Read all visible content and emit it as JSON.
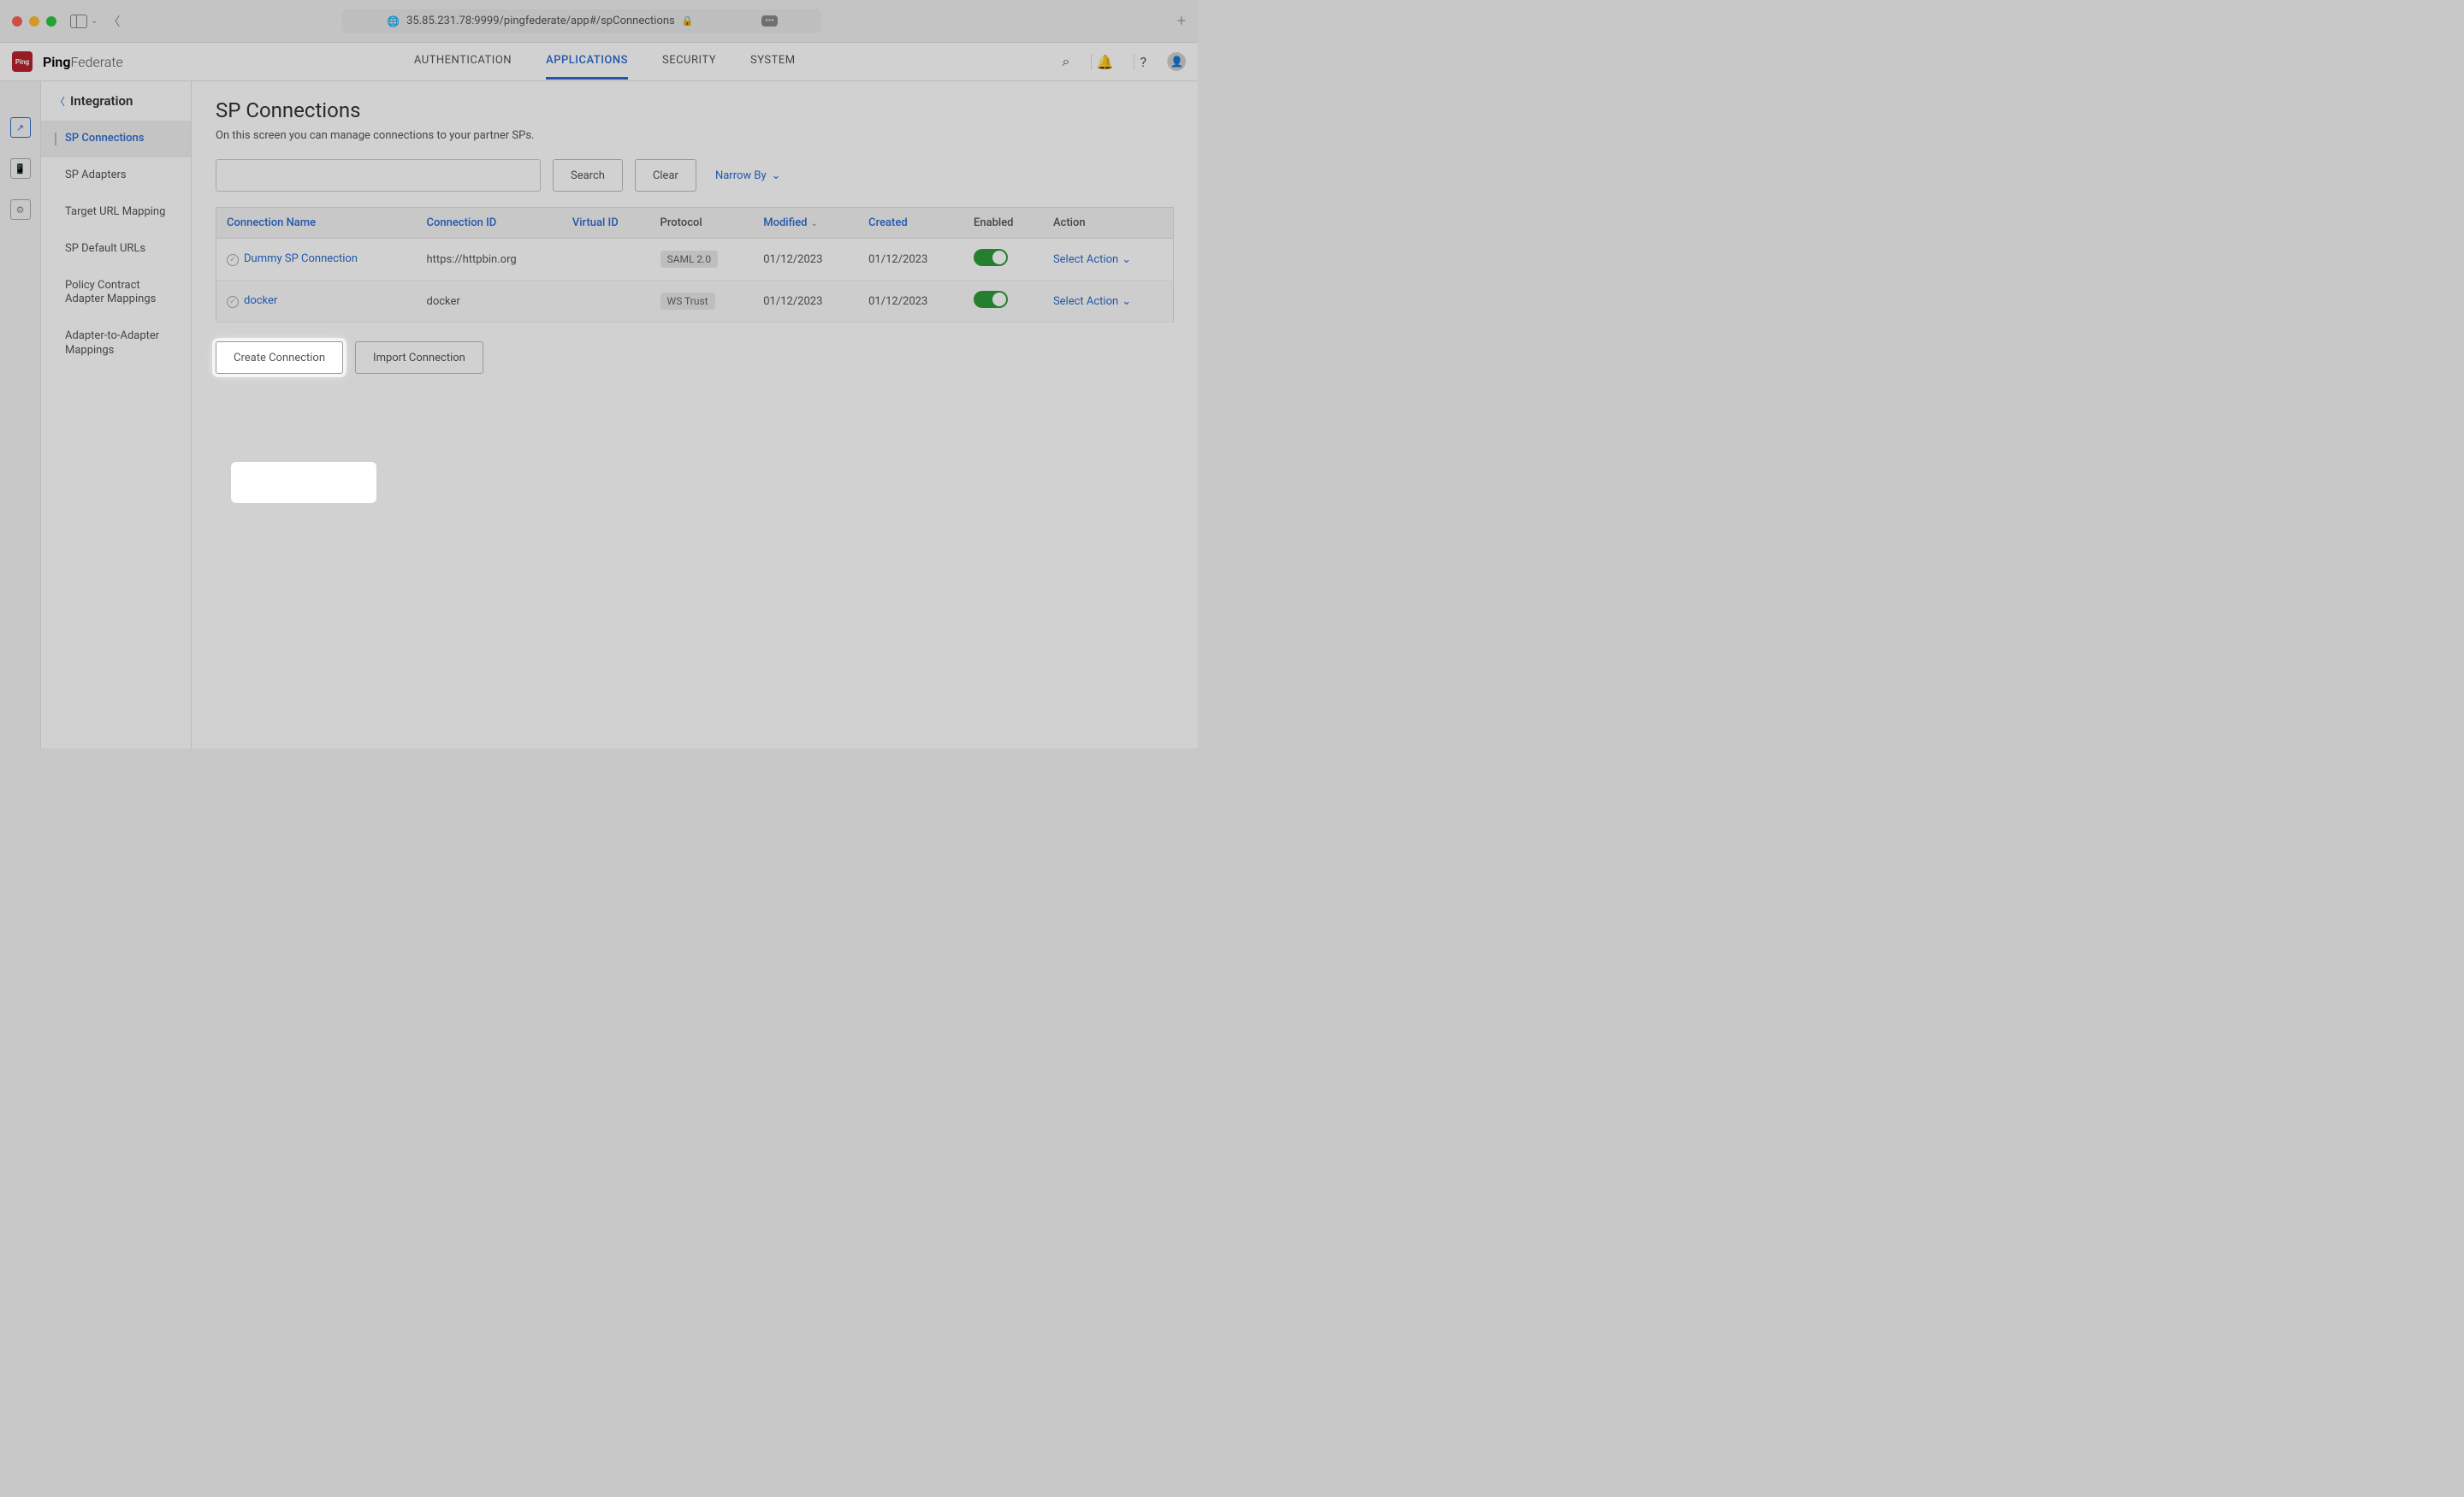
{
  "browser": {
    "url": "35.85.231.78:9999/pingfederate/app#/spConnections"
  },
  "brand": {
    "logo_mark": "Ping",
    "name_bold": "Ping",
    "name_light": "Federate"
  },
  "top_nav": {
    "items": [
      "AUTHENTICATION",
      "APPLICATIONS",
      "SECURITY",
      "SYSTEM"
    ],
    "active_index": 1
  },
  "sidebar": {
    "back_label": "Integration",
    "items": [
      "SP Connections",
      "SP Adapters",
      "Target URL Mapping",
      "SP Default URLs",
      "Policy Contract Adapter Mappings",
      "Adapter-to-Adapter Mappings"
    ],
    "active_index": 0
  },
  "page": {
    "title": "SP Connections",
    "description": "On this screen you can manage connections to your partner SPs.",
    "search_placeholder": "",
    "search_button": "Search",
    "clear_button": "Clear",
    "narrow_by": "Narrow By"
  },
  "table": {
    "columns": {
      "connection_name": "Connection Name",
      "connection_id": "Connection ID",
      "virtual_id": "Virtual ID",
      "protocol": "Protocol",
      "modified": "Modified",
      "created": "Created",
      "enabled": "Enabled",
      "action": "Action"
    },
    "rows": [
      {
        "name": "Dummy SP Connection",
        "id": "https://httpbin.org",
        "virtual_id": "",
        "protocol": "SAML 2.0",
        "modified": "01/12/2023",
        "created": "01/12/2023",
        "enabled": true,
        "action": "Select Action"
      },
      {
        "name": "docker",
        "id": "docker",
        "virtual_id": "",
        "protocol": "WS Trust",
        "modified": "01/12/2023",
        "created": "01/12/2023",
        "enabled": true,
        "action": "Select Action"
      }
    ]
  },
  "buttons": {
    "create": "Create Connection",
    "import": "Import Connection"
  }
}
